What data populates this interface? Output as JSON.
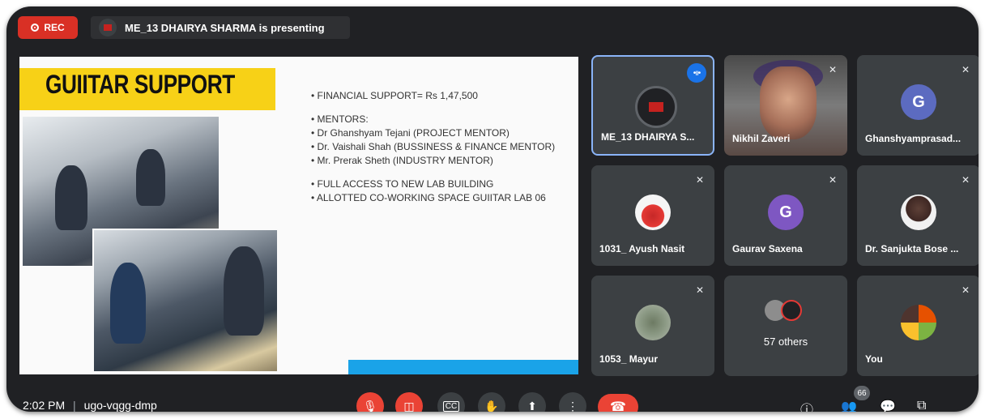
{
  "topbar": {
    "rec_label": "REC",
    "presenting_text": "ME_13 DHAIRYA SHARMA is presenting"
  },
  "slide": {
    "title": "GUIITAR SUPPORT",
    "bullets": [
      "• FINANCIAL SUPPORT= Rs 1,47,500",
      "• MENTORS:",
      "• Dr Ghanshyam Tejani (PROJECT MENTOR)",
      "• Dr. Vaishali Shah (BUSSINESS & FINANCE MENTOR)",
      "• Mr. Prerak Sheth (INDUSTRY MENTOR)",
      "• FULL ACCESS TO NEW LAB BUILDING",
      "• ALLOTTED CO-WORKING SPACE GUIITAR LAB 06"
    ]
  },
  "participants": [
    {
      "name": "ME_13 DHAIRYA S...",
      "avatar": "logo",
      "speaking": true
    },
    {
      "name": "Nikhil Zaveri",
      "avatar": "video"
    },
    {
      "name": "Ghanshyamprasad...",
      "avatar": "G",
      "color": "#5c6bc0"
    },
    {
      "name": "1031_ Ayush Nasit",
      "avatar": "photo"
    },
    {
      "name": "Gaurav Saxena",
      "avatar": "G",
      "color": "#7e57c2"
    },
    {
      "name": "Dr. Sanjukta Bose ...",
      "avatar": "photo"
    },
    {
      "name": "1053_ Mayur",
      "avatar": "photo"
    },
    {
      "name": "57 others",
      "avatar": "group"
    },
    {
      "name": "You",
      "avatar": "photo"
    }
  ],
  "bottom_bar": {
    "time": "2:02 PM",
    "separator": "|",
    "meeting_code": "ugo-vqgg-dmp",
    "people_count": "66"
  },
  "icons": {
    "mic": "mic-off-icon",
    "camera": "camera-off-icon",
    "captions": "closed-captions-icon",
    "hand": "raise-hand-icon",
    "present": "present-screen-icon",
    "more": "more-options-icon",
    "hangup": "hang-up-icon",
    "info": "info-icon",
    "people": "people-icon",
    "chat": "chat-icon",
    "activities": "activities-icon"
  }
}
